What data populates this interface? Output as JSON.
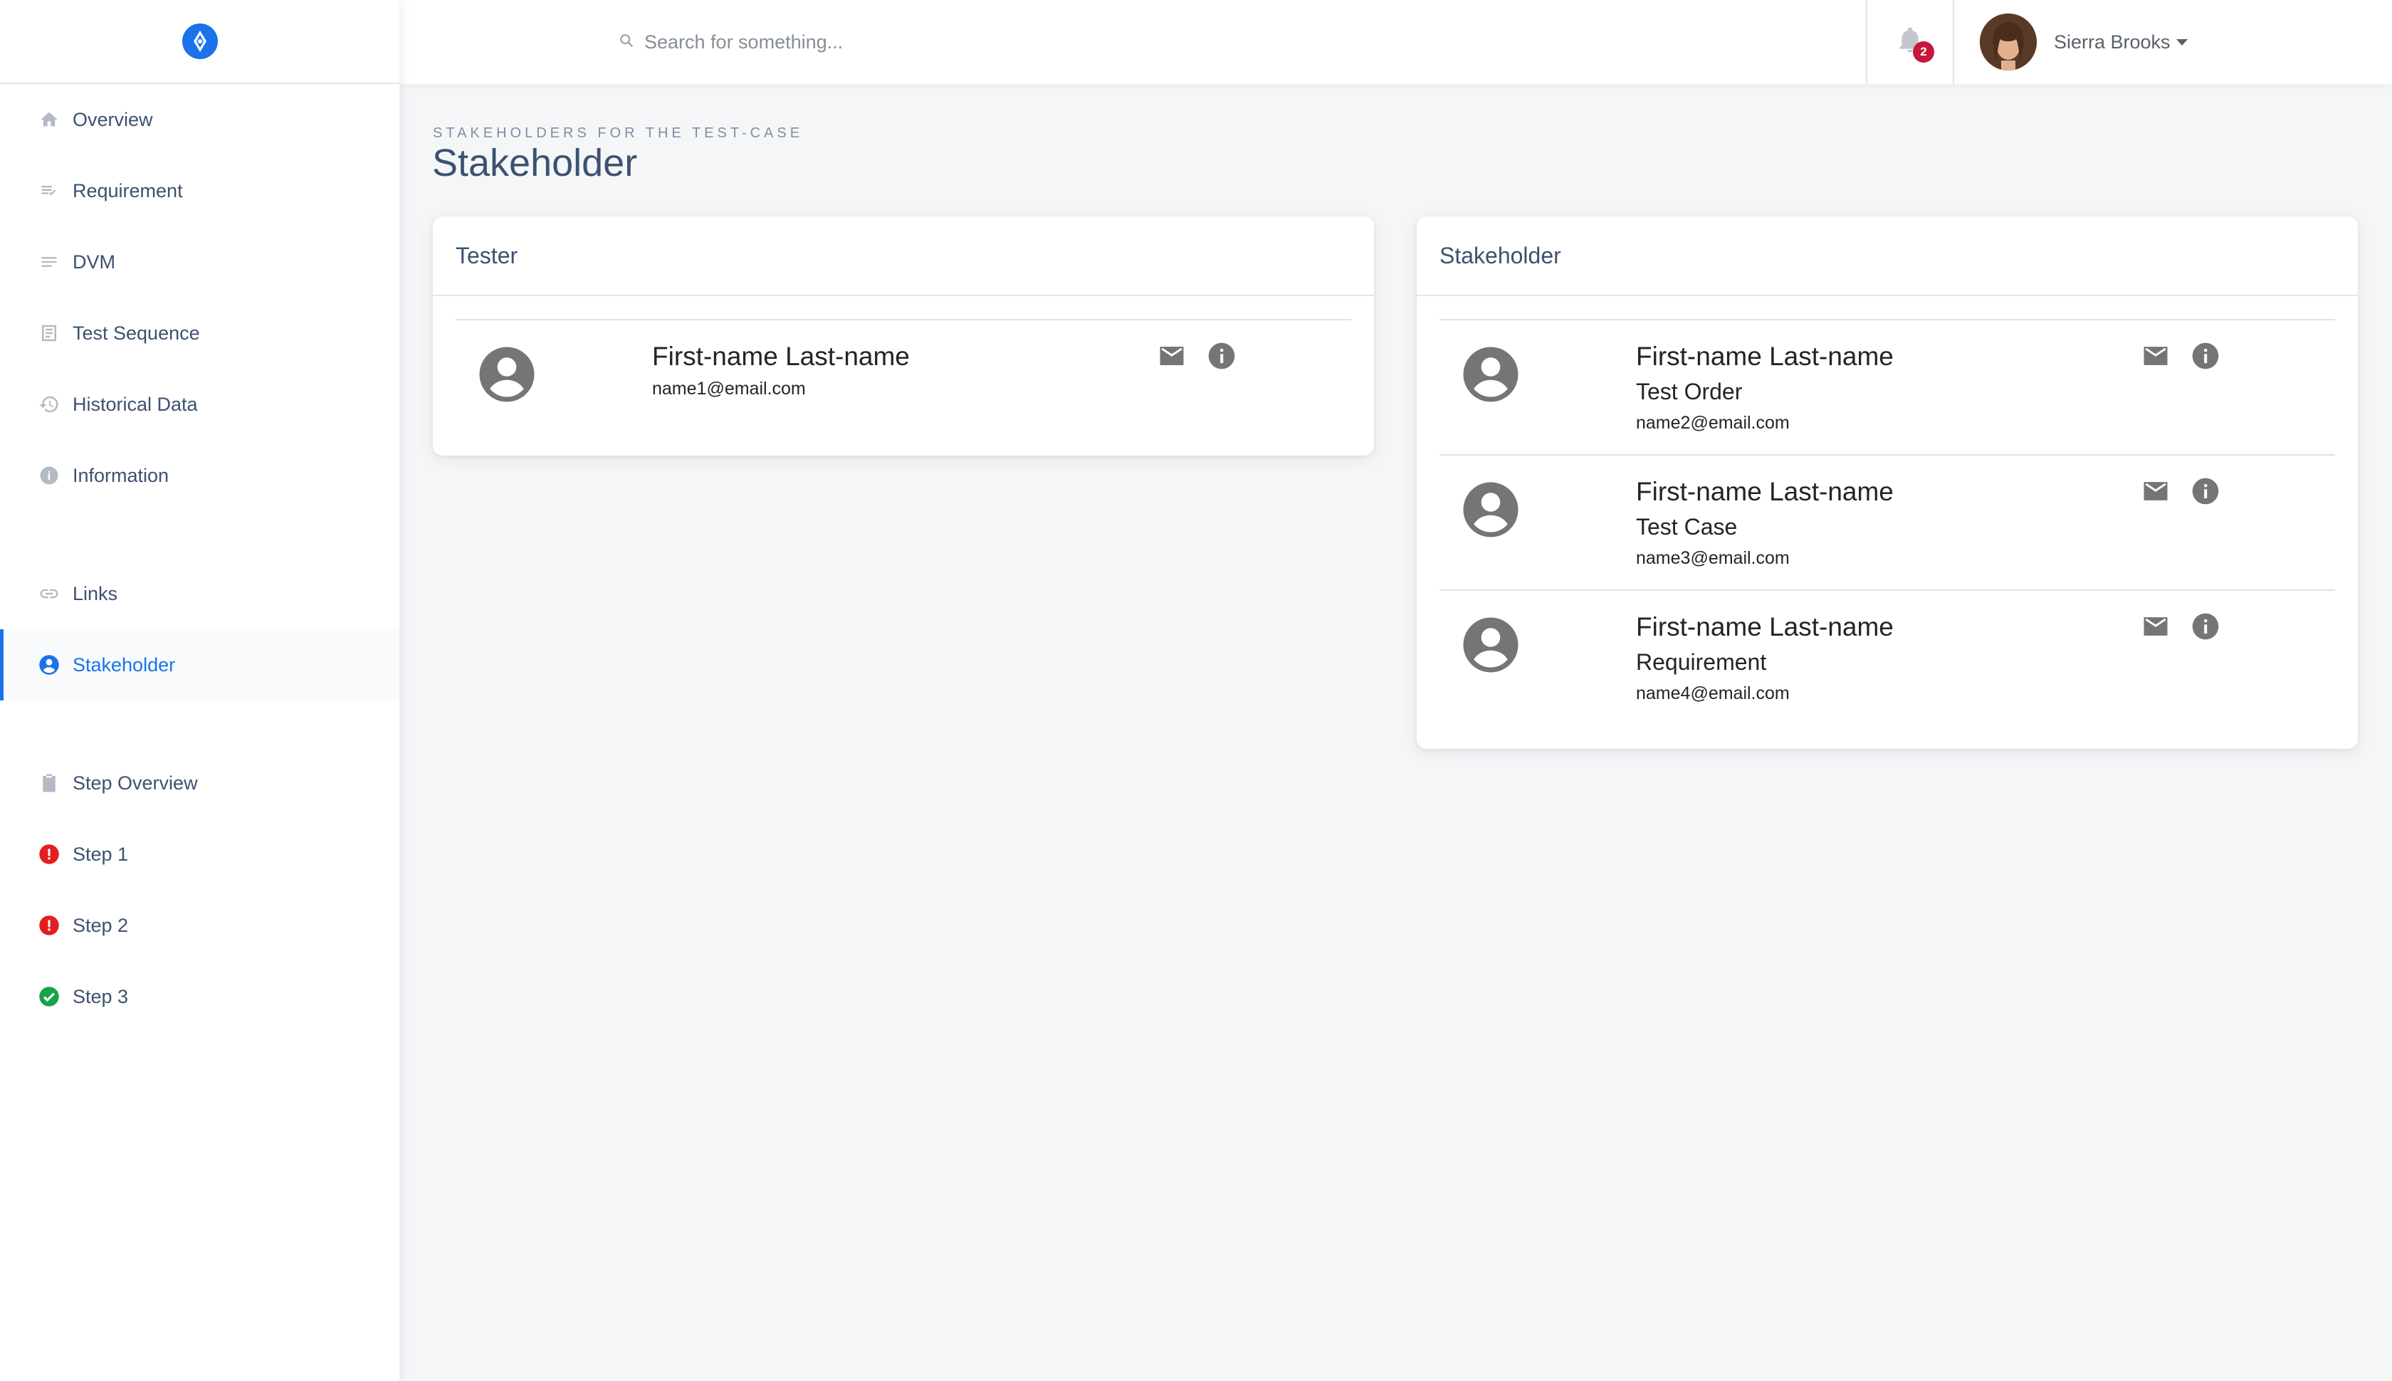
{
  "colors": {
    "accent": "#1a73e8",
    "error": "#e02020",
    "success": "#17a34a",
    "badge": "#c4183c"
  },
  "sidebar": {
    "logo_icon": "compass-logo",
    "items": [
      {
        "label": "Overview",
        "icon": "home-icon"
      },
      {
        "label": "Requirement",
        "icon": "list-check-icon"
      },
      {
        "label": "DVM",
        "icon": "lines-icon"
      },
      {
        "label": "Test Sequence",
        "icon": "document-icon"
      },
      {
        "label": "Historical Data",
        "icon": "history-icon"
      },
      {
        "label": "Information",
        "icon": "info-icon"
      },
      {
        "label": "Links",
        "icon": "link-icon"
      },
      {
        "label": "Stakeholder",
        "icon": "account-circle-icon",
        "active": true
      },
      {
        "label": "Step Overview",
        "icon": "clipboard-icon"
      },
      {
        "label": "Step 1",
        "icon": "error-icon",
        "status": "error"
      },
      {
        "label": "Step 2",
        "icon": "error-icon",
        "status": "error"
      },
      {
        "label": "Step 3",
        "icon": "check-circle-icon",
        "status": "success"
      }
    ]
  },
  "header": {
    "search": {
      "placeholder": "Search for something..."
    },
    "notifications": {
      "count": "2"
    },
    "user": {
      "name": "Sierra Brooks"
    }
  },
  "page": {
    "subtitle": "Stakeholders for the test-case",
    "title": "Stakeholder"
  },
  "cards": {
    "tester": {
      "title": "Tester",
      "people": [
        {
          "name": "First-name Last-name",
          "role": "",
          "email": "name1@email.com"
        }
      ]
    },
    "stakeholder": {
      "title": "Stakeholder",
      "people": [
        {
          "name": "First-name Last-name",
          "role": "Test Order",
          "email": "name2@email.com"
        },
        {
          "name": "First-name Last-name",
          "role": "Test Case",
          "email": "name3@email.com"
        },
        {
          "name": "First-name Last-name",
          "role": "Requirement",
          "email": "name4@email.com"
        }
      ]
    }
  }
}
